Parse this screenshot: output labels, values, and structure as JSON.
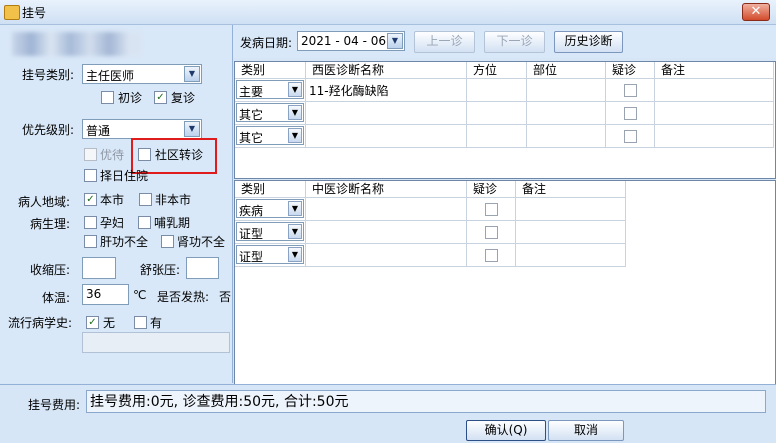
{
  "window": {
    "title": "挂号",
    "close_glyph": "✕"
  },
  "left": {
    "reg_type_label": "挂号类别:",
    "reg_type_value": "主任医师",
    "first_visit_label": "初诊",
    "first_visit_checked": false,
    "return_visit_label": "复诊",
    "return_visit_checked": true,
    "priority_label": "优先级别:",
    "priority_value": "普通",
    "vip_label": "优待",
    "community_label": "社区转诊",
    "choose_day_label": "择日住院",
    "region_label": "病人地域:",
    "local_label": "本市",
    "local_checked": true,
    "nonlocal_label": "非本市",
    "physio_label": "病生理:",
    "pregnant_label": "孕妇",
    "lactating_label": "哺乳期",
    "liver_label": "肝功不全",
    "kidney_label": "肾功不全",
    "systolic_label": "收缩压:",
    "diastolic_label": "舒张压:",
    "temp_label": "体温:",
    "temp_value": "36",
    "temp_unit": "℃",
    "fever_label": "是否发热:",
    "fever_value": "否",
    "epi_label": "流行病学史:",
    "epi_none_label": "无",
    "epi_none_checked": true,
    "epi_yes_label": "有"
  },
  "toolbar": {
    "onset_label": "发病日期:",
    "onset_date": "2021 - 04 - 06",
    "prev_label": "上一诊",
    "next_label": "下一诊",
    "history_label": "历史诊断"
  },
  "western_grid": {
    "headers": [
      "类别",
      "西医诊断名称",
      "方位",
      "部位",
      "疑诊",
      "备注"
    ],
    "rows": [
      {
        "category": "主要",
        "name": "11-羟化酶缺陷"
      },
      {
        "category": "其它",
        "name": ""
      },
      {
        "category": "其它",
        "name": ""
      }
    ]
  },
  "tcm_grid": {
    "headers": [
      "类别",
      "中医诊断名称",
      "疑诊",
      "备注"
    ],
    "rows": [
      {
        "category": "疾病"
      },
      {
        "category": "证型"
      },
      {
        "category": "证型"
      }
    ]
  },
  "footer": {
    "fee_label": "挂号费用:",
    "fee_text": "挂号费用:0元, 诊查费用:50元, 合计:50元",
    "ok_label": "确认(Q)",
    "cancel_label": "取消"
  },
  "icons": {
    "check": "✓",
    "dropdown": "▼"
  }
}
